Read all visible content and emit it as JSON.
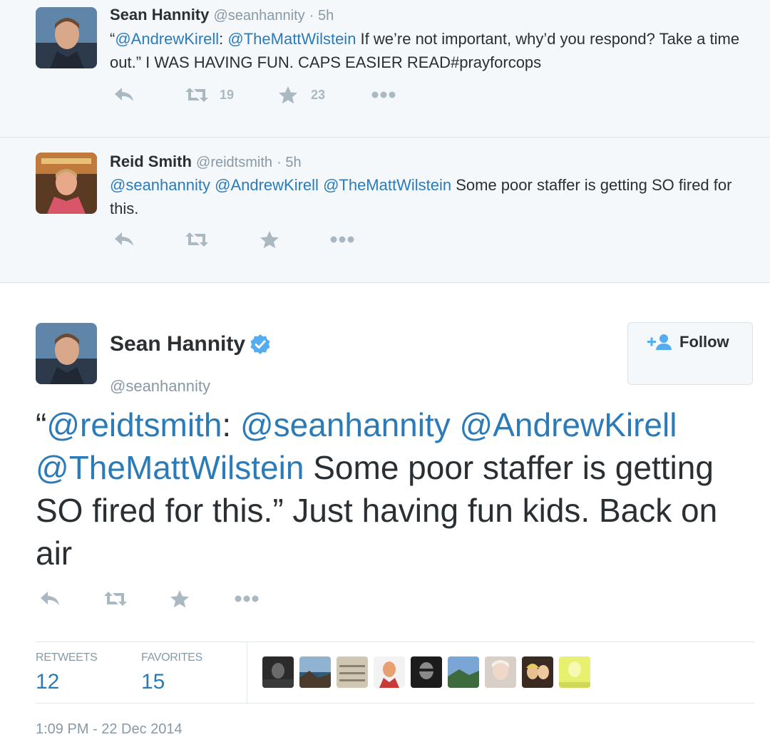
{
  "tweets": [
    {
      "name": "Sean Hannity",
      "handle": "@seanhannity",
      "time": "· 5h",
      "text": [
        {
          "t": "“",
          "m": false
        },
        {
          "t": "@AndrewKirell",
          "m": true
        },
        {
          "t": ": ",
          "m": false
        },
        {
          "t": "@TheMattWilstein",
          "m": true
        },
        {
          "t": " If we’re not important, why’d you respond? Take a time out.” I WAS HAVING FUN.  CAPS EASIER READ#prayforcops",
          "m": false
        }
      ],
      "retweets": "19",
      "favorites": "23"
    },
    {
      "name": "Reid Smith",
      "handle": "@reidtsmith",
      "time": "· 5h",
      "text": [
        {
          "t": "@seanhannity",
          "m": true
        },
        {
          "t": " ",
          "m": false
        },
        {
          "t": "@AndrewKirell",
          "m": true
        },
        {
          "t": " ",
          "m": false
        },
        {
          "t": "@TheMattWilstein",
          "m": true
        },
        {
          "t": " Some poor staffer is getting SO fired for this.",
          "m": false
        }
      ],
      "retweets": "",
      "favorites": ""
    }
  ],
  "main": {
    "name": "Sean Hannity",
    "handle": "@seanhannity",
    "follow_label": "Follow",
    "text": [
      {
        "t": "“",
        "m": false
      },
      {
        "t": "@reidtsmith",
        "m": true
      },
      {
        "t": ": ",
        "m": false
      },
      {
        "t": "@seanhannity",
        "m": true
      },
      {
        "t": " ",
        "m": false
      },
      {
        "t": "@AndrewKirell",
        "m": true
      },
      {
        "t": " ",
        "m": false
      },
      {
        "t": "@TheMattWilstein",
        "m": true
      },
      {
        "t": " Some poor staffer is getting SO fired for this.” Just having fun kids. Back on air",
        "m": false
      }
    ],
    "stats": {
      "retweets_label": "RETWEETS",
      "retweets_value": "12",
      "favorites_label": "FAVORITES",
      "favorites_value": "15"
    },
    "timestamp": "1:09 PM - 22 Dec 2014"
  },
  "icons": {
    "reply": "reply-icon",
    "retweet": "retweet-icon",
    "favorite": "star-icon",
    "more": "more-icon",
    "verified": "verified-badge-icon",
    "follow": "add-user-icon"
  },
  "colors": {
    "link": "#2b7bb9",
    "muted": "#8899a6",
    "action": "#aab8c2",
    "context_bg": "#f5f8fa",
    "verified": "#55acee"
  }
}
